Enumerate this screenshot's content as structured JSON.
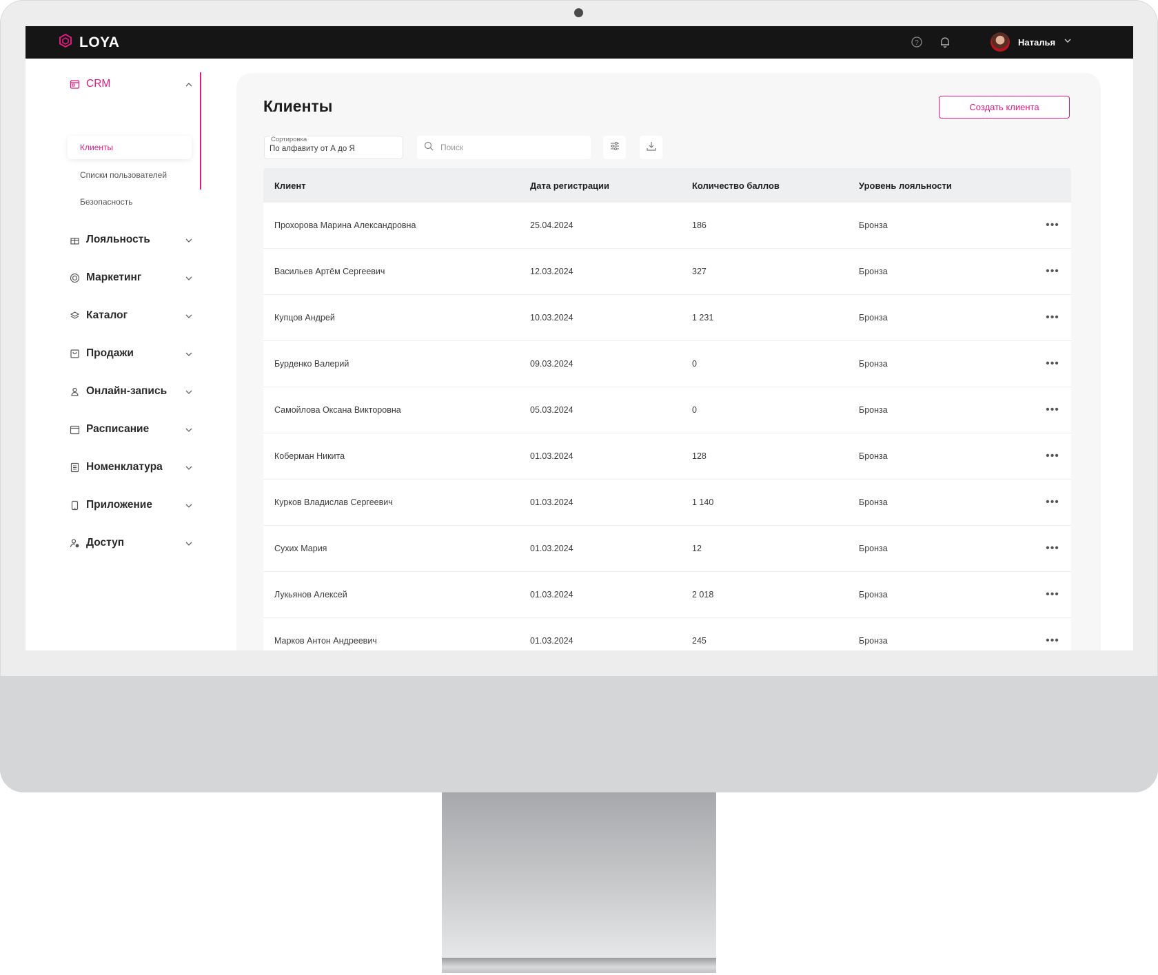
{
  "app": {
    "brand": "LOYA",
    "accent_color": "#e0197d",
    "topbar": {
      "help_icon": "question-circle-icon",
      "notifications_icon": "bell-icon",
      "user_name": "Наталья"
    }
  },
  "sidebar": {
    "crm": {
      "label": "CRM",
      "icon": "crm-icon",
      "sub_items": [
        {
          "label": "Клиенты",
          "active": true
        },
        {
          "label": "Списки пользователей",
          "active": false
        },
        {
          "label": "Безопасность",
          "active": false
        }
      ]
    },
    "items": [
      {
        "label": "Лояльность",
        "icon": "gift-icon"
      },
      {
        "label": "Маркетинг",
        "icon": "target-icon"
      },
      {
        "label": "Каталог",
        "icon": "layers-icon"
      },
      {
        "label": "Продажи",
        "icon": "bag-icon"
      },
      {
        "label": "Онлайн-запись",
        "icon": "person-icon"
      },
      {
        "label": "Расписание",
        "icon": "calendar-icon"
      },
      {
        "label": "Номенклатура",
        "icon": "list-icon"
      },
      {
        "label": "Приложение",
        "icon": "phone-icon"
      },
      {
        "label": "Доступ",
        "icon": "user-access-icon"
      }
    ]
  },
  "main": {
    "title": "Клиенты",
    "create_button": "Создать клиента",
    "sort": {
      "label": "Сортировка",
      "value": "По алфавиту от А до Я"
    },
    "search": {
      "placeholder": "Поиск"
    },
    "table": {
      "columns": [
        "Клиент",
        "Дата регистрации",
        "Количество баллов",
        "Уровень лояльности"
      ],
      "rows": [
        {
          "client": "Прохорова Марина Александровна",
          "date": "25.04.2024",
          "points": "186",
          "level": "Бронза"
        },
        {
          "client": "Васильев Артём Сергеевич",
          "date": "12.03.2024",
          "points": "327",
          "level": "Бронза"
        },
        {
          "client": "Купцов Андрей",
          "date": "10.03.2024",
          "points": "1 231",
          "level": "Бронза"
        },
        {
          "client": "Бурденко Валерий",
          "date": "09.03.2024",
          "points": "0",
          "level": "Бронза"
        },
        {
          "client": "Самойлова Оксана Викторовна",
          "date": "05.03.2024",
          "points": "0",
          "level": "Бронза"
        },
        {
          "client": "Коберман Никита",
          "date": "01.03.2024",
          "points": "128",
          "level": "Бронза"
        },
        {
          "client": "Курков Владислав Сергеевич",
          "date": "01.03.2024",
          "points": "1 140",
          "level": "Бронза"
        },
        {
          "client": "Сухих Мария",
          "date": "01.03.2024",
          "points": "12",
          "level": "Бронза"
        },
        {
          "client": "Лукьянов Алексей",
          "date": "01.03.2024",
          "points": "2 018",
          "level": "Бронза"
        },
        {
          "client": "Марков Антон Андреевич",
          "date": "01.03.2024",
          "points": "245",
          "level": "Бронза"
        }
      ]
    }
  }
}
